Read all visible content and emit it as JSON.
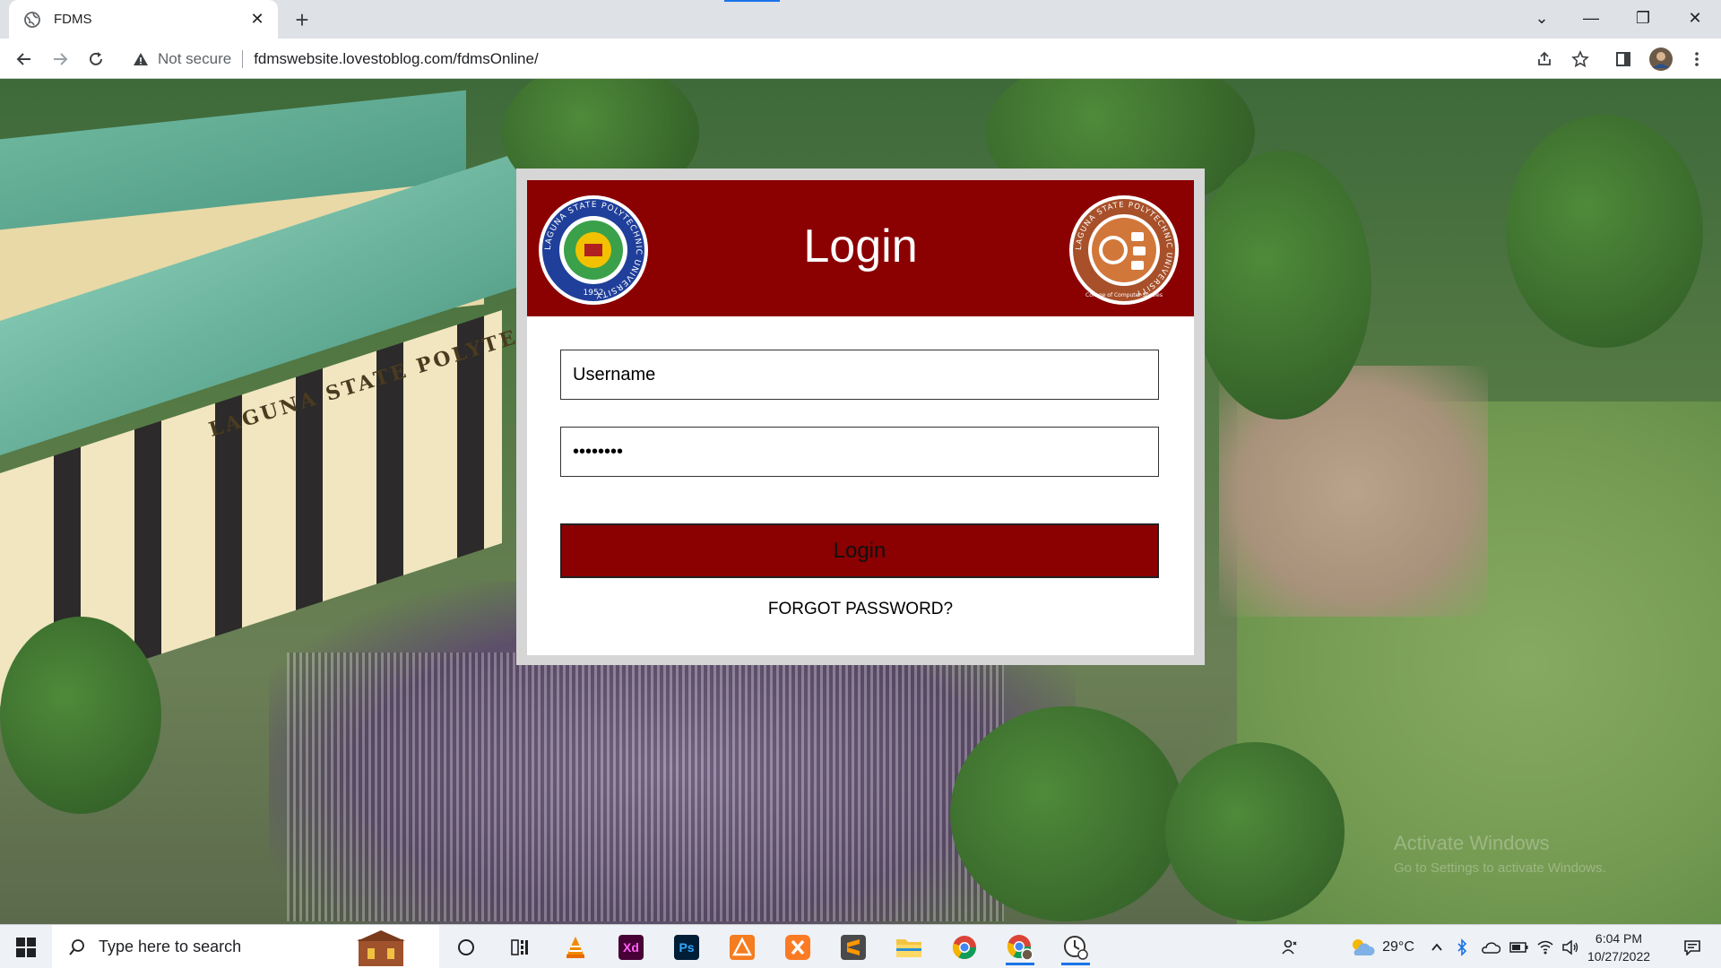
{
  "browser": {
    "tab_title": "FDMS",
    "security_label": "Not secure",
    "url": "fdmswebsite.lovestoblog.com/fdmsOnline/"
  },
  "login": {
    "title": "Login",
    "username_placeholder": "Username",
    "password_value": "••••••••",
    "button_label": "Login",
    "forgot_label": "FORGOT PASSWORD?",
    "seal_left_text": "LAGUNA STATE POLYTECHNIC UNIVERSITY",
    "seal_left_year": "1952",
    "seal_right_text": "LAGUNA STATE POLYTECHNIC UNIVERSITY",
    "seal_right_sub": "College of Computer Studies"
  },
  "background": {
    "campus_sign": "LAGUNA STATE POLYTECHNIC",
    "watermark_title": "Activate Windows",
    "watermark_sub": "Go to Settings to activate Windows."
  },
  "taskbar": {
    "search_placeholder": "Type here to search",
    "apps": [
      "file-explorer",
      "vlc",
      "adobe-xd",
      "photoshop",
      "app-orange",
      "xampp",
      "sublime-text",
      "folder",
      "chrome",
      "chrome-profile",
      "clock-app"
    ],
    "weather": "29°C",
    "time": "6:04 PM",
    "date": "10/27/2022"
  },
  "colors": {
    "header_red": "#8b0000",
    "accent_blue": "#1a73e8"
  }
}
